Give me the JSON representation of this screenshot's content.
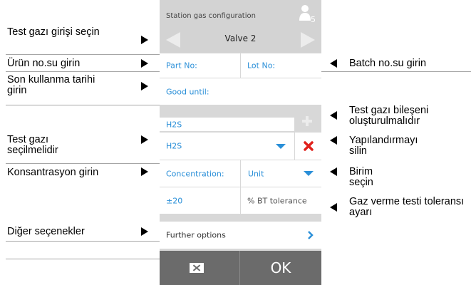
{
  "screen": {
    "title": "Station gas configuration",
    "user_badge": "5",
    "valve_label": "Valve 2",
    "part_no_label": "Part No:",
    "lot_no_label": "Lot No:",
    "good_until_label": "Good until:",
    "component_header": "H2S",
    "gas_select_value": "H2S",
    "concentration_label": "Concentration:",
    "unit_select_value": "Unit",
    "tolerance_value": "±20",
    "tolerance_unit_label": "% BT tolerance",
    "further_options_label": "Further options",
    "ok_label": "OK"
  },
  "annotations_left": {
    "select_gas_input": "Test gazı girişi seçin",
    "enter_product_no": "Ürün no.su girin",
    "enter_expiry": "Son kullanma tarihi girin",
    "gas_must_be_selected": "Test gazı seçilmelidir",
    "enter_concentration": "Konsantrasyon girin",
    "other_options": "Diğer seçenekler"
  },
  "annotations_right": {
    "enter_batch_no": "Batch no.su girin",
    "create_component": "Test gazı bileşeni oluşturulmalıdır",
    "delete_configuration": "Yapılandırmayı silin",
    "select_unit": "Birim seçin",
    "set_tolerance": "Gaz verme testi toleransı ayarı"
  },
  "colors": {
    "accent": "#2a8fd8",
    "delete_red": "#e0211c",
    "header_grey": "#d3d3d3",
    "footer_grey": "#6b6b6b"
  },
  "icons": {
    "user": "user-icon",
    "prev": "arrow-left-icon",
    "next": "arrow-right-icon",
    "add": "plus-icon",
    "delete": "close-icon",
    "dropdown": "chevron-down-icon",
    "further": "chevron-right-icon",
    "cancel": "cancel-icon"
  }
}
